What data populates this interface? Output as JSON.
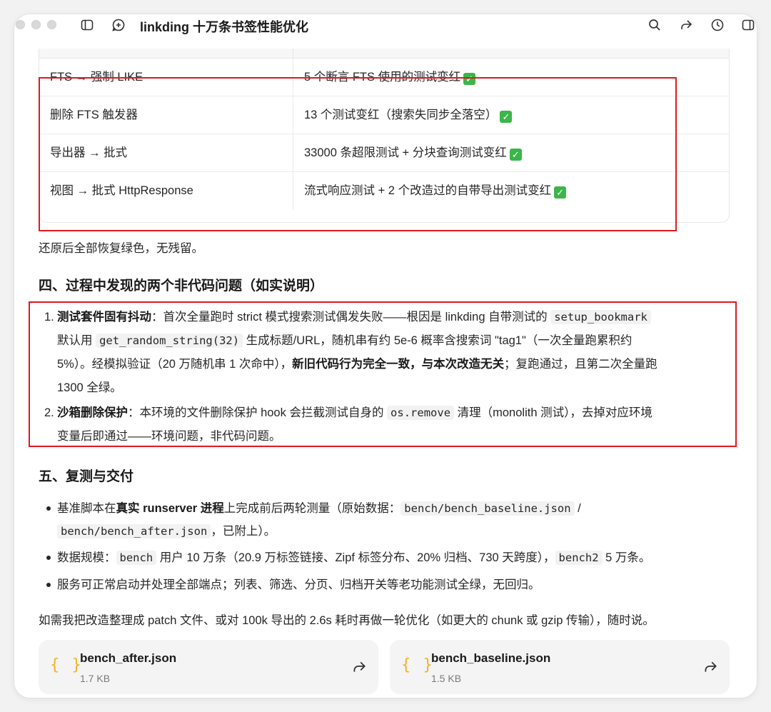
{
  "window": {
    "title": "linkding 十万条书签性能优化"
  },
  "table": {
    "rows": [
      {
        "change": "FTS → 强制 LIKE",
        "result": "5 个断言 FTS 使用的测试变红",
        "ok": "✓"
      },
      {
        "change": "删除 FTS 触发器",
        "result": "13 个测试变红（搜索失同步全落空）",
        "ok": "✓"
      },
      {
        "change": "导出器 → 批式",
        "result": "33000 条超限测试 + 分块查询测试变红",
        "ok": "✓"
      },
      {
        "change": "视图 → 批式 HttpResponse",
        "result": "流式响应测试 + 2 个改造过的自带导出测试变红",
        "ok": "✓"
      }
    ]
  },
  "after_table_text": "还原后全部恢复绿色，无残留。",
  "section4": {
    "heading": "四、过程中发现的两个非代码问题（如实说明）",
    "items": [
      {
        "num": "1.",
        "bold1": "测试套件固有抖动",
        "t1": "：首次全量跑时 strict 模式搜索测试偶发失败——根因是 linkding 自带测试的 ",
        "code1": "setup_bookmark",
        "t2": "默认用 ",
        "code2": "get_random_string(32)",
        "t3": " 生成标题/URL，随机串有约 5e-6 概率含搜索词 \"tag1\"（一次全量跑累积约",
        "t4": "5%）。经模拟验证（20 万随机串 1 次命中），",
        "bold2": "新旧代码行为完全一致，与本次改造无关",
        "t5": "；复跑通过，且第二次全量跑",
        "t6": "1300 全绿。"
      },
      {
        "num": "2.",
        "bold1": "沙箱删除保护",
        "t1": "：本环境的文件删除保护 hook 会拦截测试自身的 ",
        "code1": "os.remove",
        "t2": " 清理（monolith 测试），去掉对应环境",
        "t3": "变量后即通过——环境问题，非代码问题。"
      }
    ]
  },
  "section5": {
    "heading": "五、复测与交付",
    "bullets": [
      {
        "t1": "基准脚本在",
        "bold1": "真实 runserver 进程",
        "t2": "上完成前后两轮测量（原始数据：",
        "code1": "bench/bench_baseline.json",
        "t3": " /",
        "code2": "bench/bench_after.json",
        "t4": "，已附上）。"
      },
      {
        "t1": "数据规模：",
        "code1": "bench",
        "t2": " 用户 10 万条（20.9 万标签链接、Zipf 标签分布、20% 归档、730 天跨度），",
        "code2": "bench2",
        "t3": " 5 万条。"
      },
      {
        "t1": "服务可正常启动并处理全部端点；列表、筛选、分页、归档开关等老功能测试全绿，无回归。"
      }
    ]
  },
  "closing": "如需我把改造整理成 patch 文件、或对 100k 导出的 2.6s 耗时再做一轮优化（如更大的 chunk 或 gzip 传输），随时说。",
  "attachments": [
    {
      "name": "bench_after.json",
      "size": "1.7 KB",
      "icon": "{ }"
    },
    {
      "name": "bench_baseline.json",
      "size": "1.5 KB",
      "icon": "{ }"
    }
  ],
  "colors": {
    "highlight_box": "#e0191f",
    "check": "#3cb54a",
    "json_icon": "#f0b429"
  }
}
